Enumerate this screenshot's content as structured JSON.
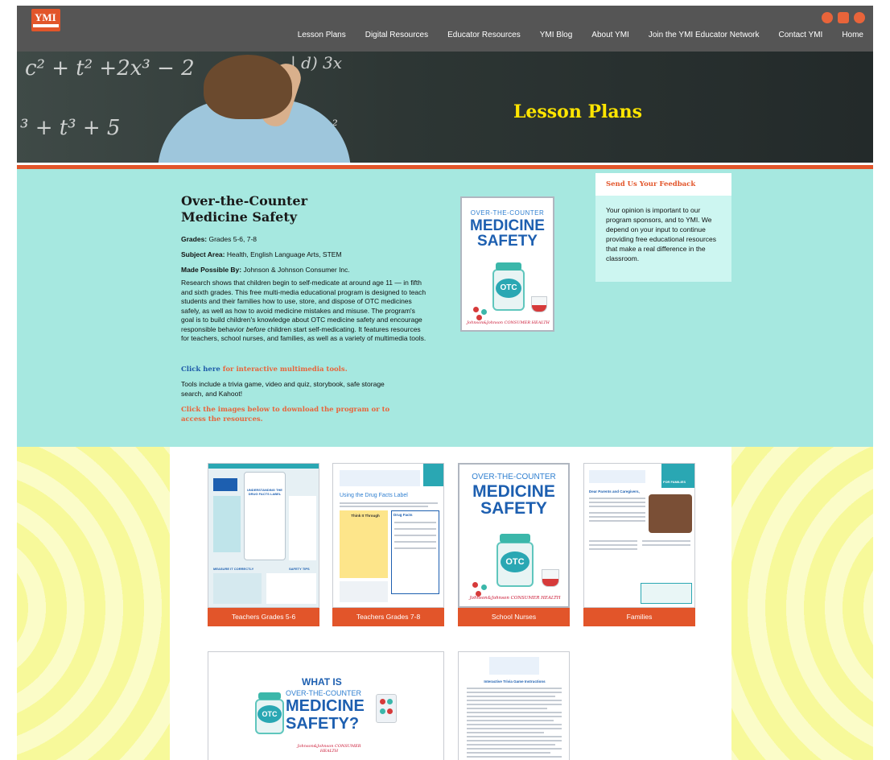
{
  "header": {
    "logo_text": "YMI",
    "social": [
      {
        "icon": "facebook-icon",
        "color": "#e8643a"
      },
      {
        "icon": "instagram-icon",
        "color": "#e8643a"
      },
      {
        "icon": "pinterest-icon",
        "color": "#e8643a"
      }
    ],
    "nav": [
      "Lesson Plans",
      "Digital Resources",
      "Educator Resources",
      "YMI Blog",
      "About YMI",
      "Join the YMI Educator Network",
      "Contact YMI",
      "Home"
    ]
  },
  "hero": {
    "title": "Lesson Plans",
    "title_color": "#ffe500",
    "accent_color": "#e2552a"
  },
  "lesson": {
    "title_line1": "Over-the-Counter",
    "title_line2": "Medicine Safety",
    "grades_label": "Grades:",
    "grades_value": " Grades 5-6, 7-8",
    "subject_label": "Subject Area:",
    "subject_value": " Health, English Language Arts, STEM",
    "sponsor_label": "Made Possible By:",
    "sponsor_value": " Johnson & Johnson Consumer Inc.",
    "description_part1": "Research shows that children begin to self-medicate at around age 11 — in fifth and sixth grades. This free multi-media educational program is designed to teach students and their families how to use, store, and dispose of OTC medicines safely, as well as how to avoid medicine mistakes and misuse. The program's goal is to build children's knowledge about OTC medicine safety and encourage responsible behavior ",
    "description_em": "before",
    "description_part2": " children start self-medicating. It features resources for teachers, school nurses, and families, as well as a variety of multimedia tools.",
    "click_here": "Click here",
    "click_rest": " for interactive multimedia tools.",
    "tools": "Tools include a trivia game, video and quiz, storybook, safe storage search, and Kahoot!",
    "download_note": "Click the images below to download the program or to access the resources."
  },
  "cover": {
    "line_small": "OVER-THE-COUNTER",
    "line_big1": "MEDICINE",
    "line_big2": "SAFETY",
    "otc": "OTC",
    "brand": "Johnson&Johnson CONSUMER HEALTH"
  },
  "feedback": {
    "title": "Send Us Your Feedback",
    "text": "Your opinion is important to our program sponsors, and to YMI. We depend on your input to continue providing free educational resources that make a real difference in the classroom."
  },
  "resources": {
    "cards": [
      {
        "label": "Teachers Grades 5-6"
      },
      {
        "label": "Teachers Grades 7-8"
      },
      {
        "label": "School Nurses"
      },
      {
        "label": "Families"
      }
    ],
    "thumb_texts": {
      "t56_title": "UNDERSTANDING THE DRUG FACTS LABEL",
      "t56_measure": "MEASURE IT CORRECTLY",
      "t56_safety": "SAFETY TIPS",
      "t78_heading": "Using the Drug Facts Label",
      "t78_box": "Think It Through",
      "t78_drug": "Drug Facts",
      "fam_tag": "FOR FAMILIES",
      "fam_heading": "Dear Parents and Caregivers,",
      "wi_what": "WHAT IS",
      "wi_over": "OVER-THE-COUNTER",
      "wi_med": "MEDICINE",
      "wi_safety": "SAFETY?",
      "trivia_title": "Interactive Trivia Game Instructions"
    }
  }
}
